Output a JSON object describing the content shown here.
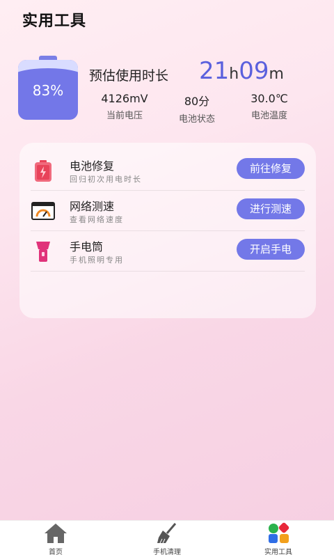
{
  "header": {
    "title": "实用工具"
  },
  "battery": {
    "percent_text": "83%",
    "level": 0.83,
    "estimate_label": "预估使用时长",
    "hours": "21",
    "hours_unit": "h",
    "minutes": "09",
    "minutes_unit": "m",
    "stats": [
      {
        "value": "4126mV",
        "label": "当前电压"
      },
      {
        "value": "80分",
        "label": "电池状态"
      },
      {
        "value": "30.0℃",
        "label": "电池温度"
      }
    ]
  },
  "tools": [
    {
      "title": "电池修复",
      "subtitle": "回归初次用电时长",
      "button": "前往修复",
      "icon": "battery-repair-icon"
    },
    {
      "title": "网络测速",
      "subtitle": "查看网络速度",
      "button": "进行测速",
      "icon": "speed-test-icon"
    },
    {
      "title": "手电筒",
      "subtitle": "手机照明专用",
      "button": "开启手电",
      "icon": "flashlight-icon"
    }
  ],
  "nav": [
    {
      "label": "首页",
      "icon": "home-icon"
    },
    {
      "label": "手机清理",
      "icon": "broom-icon"
    },
    {
      "label": "实用工具",
      "icon": "tools-grid-icon",
      "active": true
    }
  ],
  "colors": {
    "accent": "#7378e8",
    "time_accent": "#5a60dd",
    "repair_red": "#e8435a",
    "flash_pink": "#e0337a"
  }
}
